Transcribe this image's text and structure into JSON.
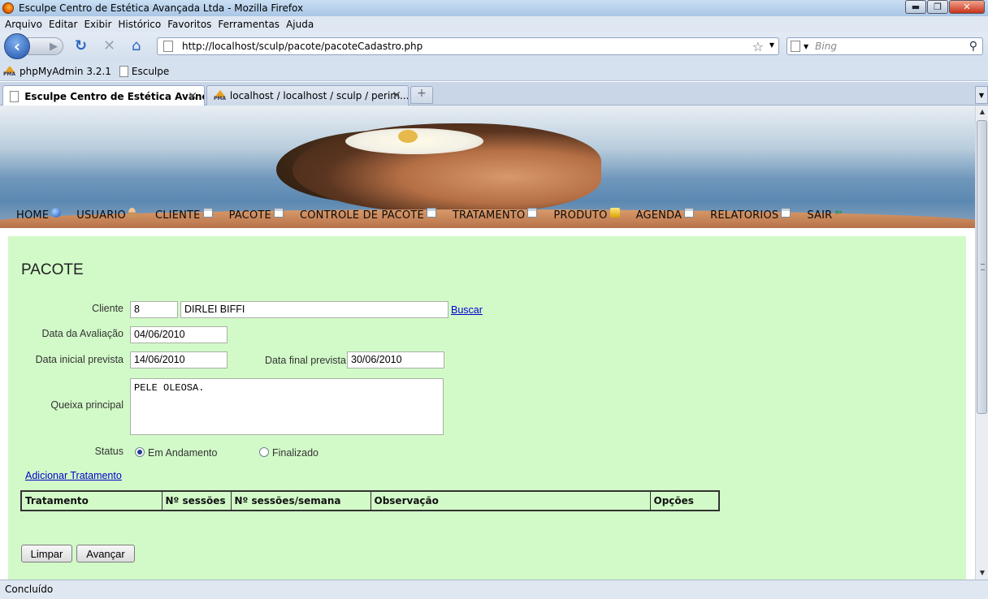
{
  "window": {
    "title": "Esculpe Centro de Estética Avançada Ltda - Mozilla Firefox",
    "min": "▬",
    "max": "❐",
    "close": "✕"
  },
  "menu": [
    "Arquivo",
    "Editar",
    "Exibir",
    "Histórico",
    "Favoritos",
    "Ferramentas",
    "Ajuda"
  ],
  "toolbar": {
    "url": "http://localhost/sculp/pacote/pacoteCadastro.php",
    "search_placeholder": "Bing",
    "icons": [
      "back-icon",
      "forward-icon",
      "reload-icon",
      "stop-icon",
      "home-icon",
      "bookmark-star-icon",
      "search-icon"
    ]
  },
  "bookmarks": [
    "phpMyAdmin 3.2.1",
    "Esculpe"
  ],
  "tabs": [
    {
      "label": "Esculpe Centro de Estética Avanç..."
    },
    {
      "label": "localhost / localhost / sculp / perim..."
    }
  ],
  "nav": [
    {
      "label": "HOME",
      "icon": "globe-icon"
    },
    {
      "label": "USUARIO",
      "icon": "user-icon"
    },
    {
      "label": "CLIENTE",
      "icon": "clients-icon"
    },
    {
      "label": "PACOTE",
      "icon": "document-icon"
    },
    {
      "label": "CONTROLE DE PACOTE",
      "icon": "edit-document-icon"
    },
    {
      "label": "TRATAMENTO",
      "icon": "document-icon"
    },
    {
      "label": "PRODUTO",
      "icon": "products-icon"
    },
    {
      "label": "AGENDA",
      "icon": "calendar-icon"
    },
    {
      "label": "RELATORIOS",
      "icon": "report-icon"
    },
    {
      "label": "SAIR",
      "icon": "exit-icon"
    }
  ],
  "form": {
    "title": "PACOTE",
    "cliente_label": "Cliente",
    "cliente_id": "8",
    "cliente_nome": "DIRLEI BIFFI",
    "buscar": "Buscar",
    "data_avaliacao_label": "Data da Avaliação",
    "data_avaliacao": "04/06/2010",
    "data_inicial_label": "Data inicial prevista",
    "data_inicial": "14/06/2010",
    "data_final_label": "Data final prevista",
    "data_final": "30/06/2010",
    "queixa_label": "Queixa principal",
    "queixa": "PELE OLEOSA.",
    "status_label": "Status",
    "status_options": [
      "Em Andamento",
      "Finalizado"
    ],
    "status_selected": "Em Andamento",
    "add_tratamento": "Adicionar Tratamento",
    "table_headers": [
      "Tratamento",
      "Nº sessões",
      "Nº sessões/semana",
      "Observação",
      "Opções"
    ],
    "btn_limpar": "Limpar",
    "btn_avancar": "Avançar"
  },
  "status_bar": "Concluído"
}
